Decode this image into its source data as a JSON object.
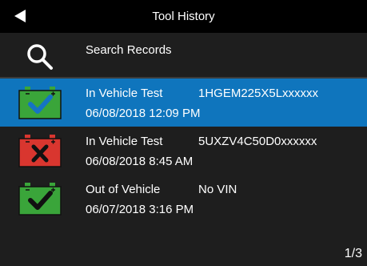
{
  "header": {
    "title": "Tool History",
    "back_icon": "back-arrow-icon"
  },
  "search": {
    "label": "Search Records",
    "icon": "search-icon"
  },
  "records": [
    {
      "type": "In Vehicle Test",
      "vin": "1HGEM225X5Lxxxxxx",
      "datetime": "06/08/2018  12:09 PM",
      "status": "pass",
      "icon": "battery-check-icon",
      "selected": true
    },
    {
      "type": "In Vehicle Test",
      "vin": "5UXZV4C50D0xxxxxx",
      "datetime": "06/08/2018  8:45 AM",
      "status": "fail",
      "icon": "battery-fail-icon",
      "selected": false
    },
    {
      "type": "Out of Vehicle",
      "vin": "No VIN",
      "datetime": "06/07/2018  3:16 PM",
      "status": "pass",
      "icon": "battery-check-icon",
      "selected": false
    }
  ],
  "pagination": {
    "label": "1/3"
  },
  "colors": {
    "selected_row": "#0f75bd",
    "background": "#1e1e1e",
    "header": "#000000",
    "pass": "#3aa53a",
    "fail": "#d9362f",
    "check_mark": "#1574c4"
  }
}
